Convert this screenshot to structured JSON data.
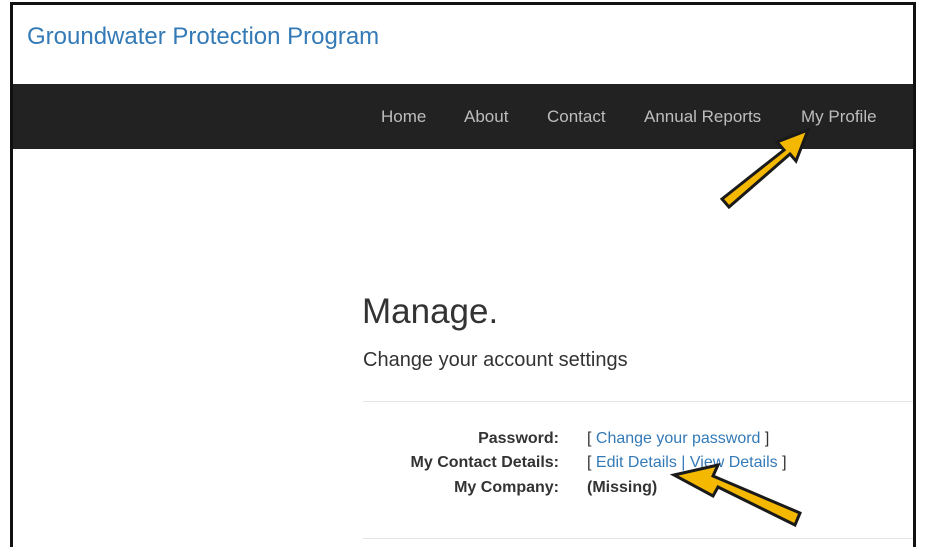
{
  "brand": {
    "title": "Groundwater Protection Program"
  },
  "nav": {
    "items": [
      "Home",
      "About",
      "Contact",
      "Annual Reports",
      "My Profile"
    ]
  },
  "page": {
    "title": "Manage.",
    "subtitle": "Change your account settings"
  },
  "settings": {
    "password_label": "Password:",
    "change_password_link": "Change your password",
    "contact_label": "My Contact Details:",
    "edit_details_link": "Edit Details",
    "separator": "|",
    "view_details_link": "View Details",
    "company_label": "My Company:",
    "company_value": "(Missing)",
    "bracket_open": "[",
    "bracket_close": "]"
  },
  "colors": {
    "brand": "#337ab7",
    "navbar": "#222222",
    "nav_text": "#bdbdbd",
    "arrow_fill": "#f5b800",
    "arrow_stroke": "#1a1a1a"
  }
}
